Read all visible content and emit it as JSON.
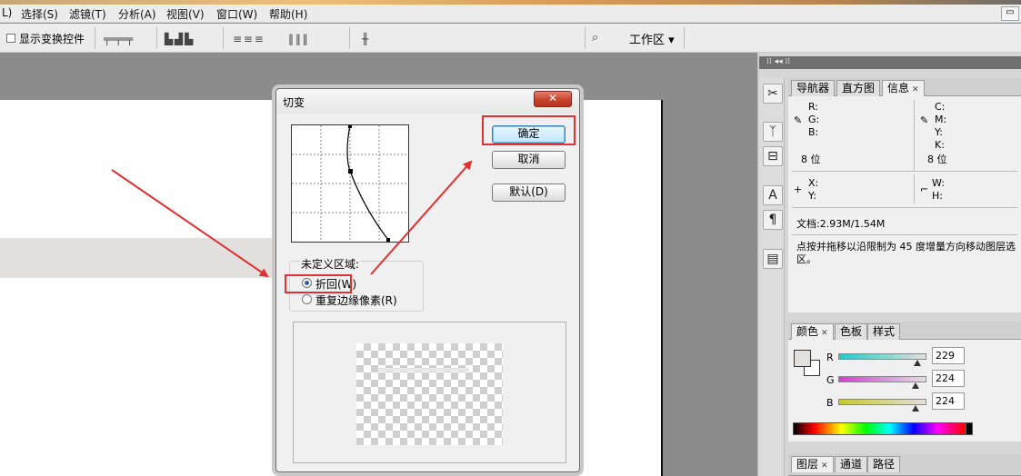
{
  "menubar": {
    "items": [
      "L)",
      "选择(S)",
      "滤镜(T)",
      "分析(A)",
      "视图(V)",
      "窗口(W)",
      "帮助(H)"
    ],
    "minimize": "▭"
  },
  "options_bar": {
    "show_transform_label": "显示变换控件",
    "workarea_label": "工作区 ▾"
  },
  "tool_icons": [
    "crop-tool-icon",
    "brush-tool-icon",
    "stamp-tool-icon",
    "type-tool-icon",
    "paragraph-tool-icon",
    "notes-tool-icon"
  ],
  "info_panel": {
    "tabs": [
      "导航器",
      "直方图",
      "信息"
    ],
    "r": "R:",
    "g": "G:",
    "b": "B:",
    "c": "C:",
    "m": "M:",
    "y": "Y:",
    "k": "K:",
    "bits_left": "8 位",
    "bits_right": "8 位",
    "x": "X:",
    "ylabel": "Y:",
    "w": "W:",
    "h": "H:",
    "doc": "文档:2.93M/1.54M",
    "hint": "点按并拖移以沿限制为 45 度增量方向移动图层选区。"
  },
  "color_panel": {
    "tabs": [
      "颜色",
      "色板",
      "样式"
    ],
    "r_label": "R",
    "g_label": "G",
    "b_label": "B",
    "r_value": "229",
    "g_value": "224",
    "b_value": "224",
    "r_level": 0.898,
    "g_level": 0.878,
    "b_level": 0.878
  },
  "layers_panel": {
    "tabs": [
      "图层",
      "通道",
      "路径"
    ]
  },
  "dialog": {
    "title": "切变",
    "close": "✕",
    "ok": "确定",
    "cancel": "取消",
    "default": "默认(D)",
    "group_label": "未定义区域:",
    "option_wrap": "折回(W)",
    "option_repeat": "重复边缘像素(R)",
    "selected_option": "wrap"
  },
  "colors": {
    "annotation_red": "#e03030",
    "slider_r": "#30c0c0",
    "slider_g": "#d040d0",
    "slider_b": "#d0d040"
  }
}
